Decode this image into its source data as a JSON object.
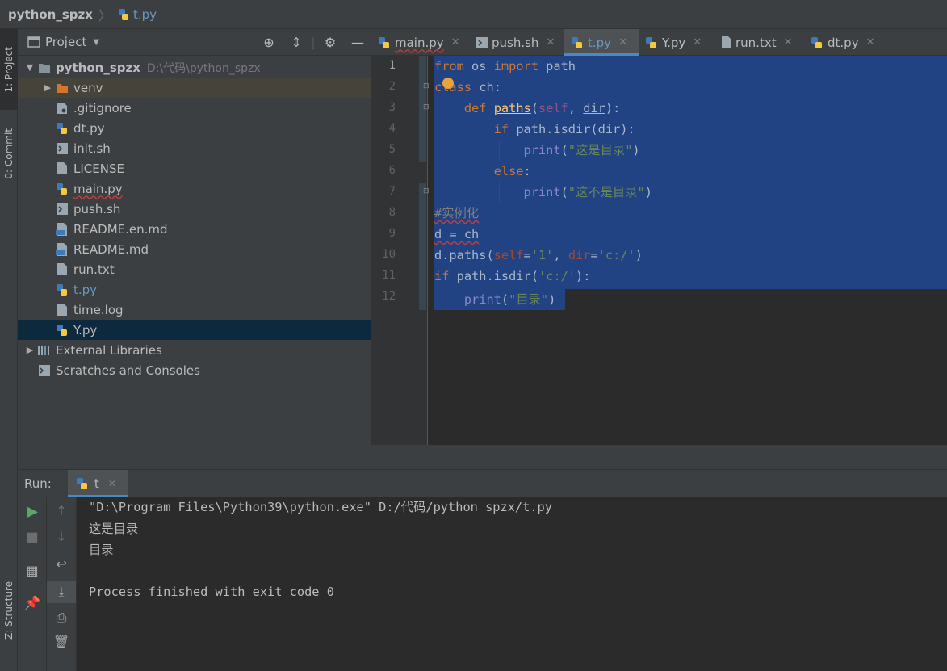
{
  "breadcrumb": {
    "project": "python_spzx",
    "separator": "〉",
    "file": "t.py"
  },
  "left_strip": {
    "project_tab": "1: Project",
    "commit_tab": "0: Commit",
    "structure_tab": "Z: Structure"
  },
  "project_panel": {
    "title": "Project",
    "tree": [
      {
        "label": "python_spzx",
        "path": "D:\\代码\\python_spzx",
        "type": "root"
      },
      {
        "label": "venv",
        "type": "folder"
      },
      {
        "label": ".gitignore",
        "type": "gitignore"
      },
      {
        "label": "dt.py",
        "type": "python"
      },
      {
        "label": "init.sh",
        "type": "shell"
      },
      {
        "label": "LICENSE",
        "type": "text"
      },
      {
        "label": "main.py",
        "type": "python"
      },
      {
        "label": "push.sh",
        "type": "shell"
      },
      {
        "label": "README.en.md",
        "type": "markdown"
      },
      {
        "label": "README.md",
        "type": "markdown"
      },
      {
        "label": "run.txt",
        "type": "text"
      },
      {
        "label": "t.py",
        "type": "python"
      },
      {
        "label": "time.log",
        "type": "text"
      },
      {
        "label": "Y.py",
        "type": "python"
      },
      {
        "label": "External Libraries",
        "type": "libraries"
      },
      {
        "label": "Scratches and Consoles",
        "type": "scratches"
      }
    ]
  },
  "editor_tabs": [
    {
      "label": "main.py",
      "icon": "python-icon"
    },
    {
      "label": "push.sh",
      "icon": "shell-icon"
    },
    {
      "label": "t.py",
      "icon": "python-icon",
      "active": true
    },
    {
      "label": "Y.py",
      "icon": "python-icon"
    },
    {
      "label": "run.txt",
      "icon": "text-icon"
    },
    {
      "label": "dt.py",
      "icon": "python-icon"
    }
  ],
  "editor": {
    "line_numbers": [
      "1",
      "2",
      "3",
      "4",
      "5",
      "6",
      "7",
      "8",
      "9",
      "10",
      "11",
      "12"
    ],
    "code": {
      "l1": [
        "from",
        " os ",
        "import",
        " path"
      ],
      "l2": [
        "class",
        " ch:"
      ],
      "l3": [
        "def",
        "paths",
        "(",
        "self",
        ", ",
        "dir",
        "):"
      ],
      "l4": [
        "if",
        " path.isdir(dir):"
      ],
      "l5": [
        "print",
        "(",
        "\"这是目录\"",
        ")"
      ],
      "l6": [
        "else",
        ":"
      ],
      "l7": [
        "print",
        "(",
        "\"这不是目录\"",
        ")"
      ],
      "l8": [
        "#实例化"
      ],
      "l9": [
        "d = ch"
      ],
      "l10": [
        "d.paths(",
        "self",
        "=",
        "'1'",
        ", ",
        "dir",
        "=",
        "'c:/'",
        ")"
      ],
      "l11": [
        "if",
        " path.isdir(",
        "'c:/'",
        "):"
      ],
      "l12": [
        "print",
        "(",
        "\"目录\"",
        ")"
      ]
    }
  },
  "run_panel": {
    "label": "Run:",
    "tab": "t",
    "output": [
      "\"D:\\Program Files\\Python39\\python.exe\" D:/代码/python_spzx/t.py",
      "这是目录",
      "目录",
      "",
      "Process finished with exit code 0"
    ]
  },
  "colors": {
    "accent": "#4a88c7",
    "selection": "#214283",
    "keyword": "#cc7832",
    "string": "#6a8759",
    "function": "#ffc66d"
  }
}
